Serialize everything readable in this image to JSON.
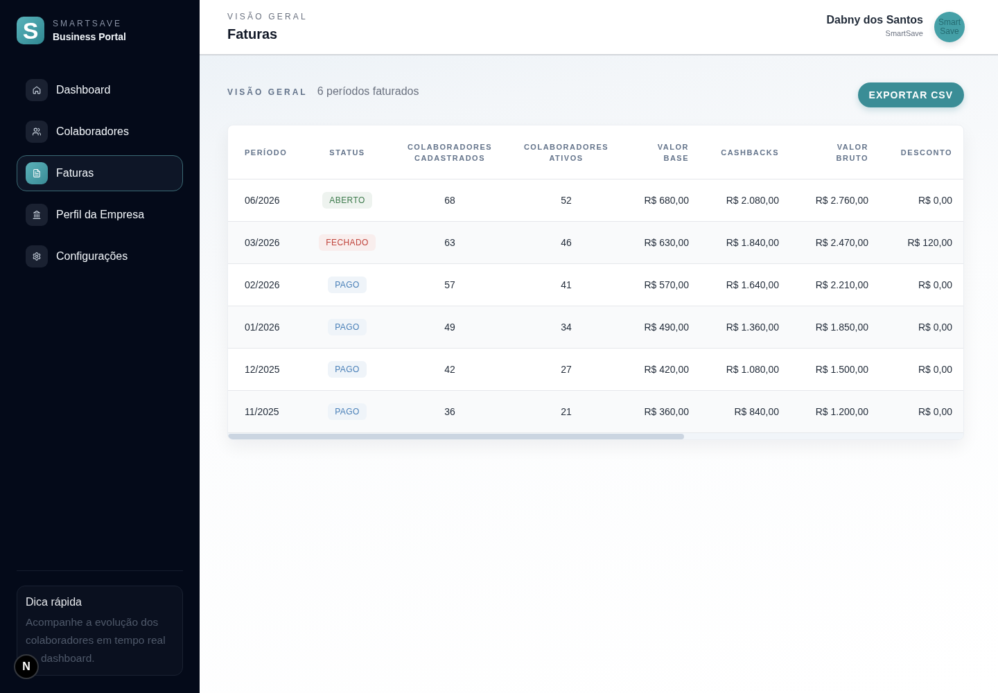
{
  "sidebar": {
    "logo": {
      "letter": "S",
      "brand": "SMARTSAVE",
      "subtitle": "Business Portal"
    },
    "items": [
      {
        "label": "Dashboard",
        "selected": false
      },
      {
        "label": "Colaboradores",
        "selected": false
      },
      {
        "label": "Faturas",
        "selected": true
      },
      {
        "label": "Perfil da Empresa",
        "selected": false
      },
      {
        "label": "Configurações",
        "selected": false
      }
    ],
    "tip": {
      "title": "Dica rápida",
      "text": "Acompanhe a evolução dos colaboradores em tempo real",
      "text_continued": "dashboard."
    },
    "dev_badge": {
      "letter": "N"
    }
  },
  "header": {
    "eyebrow": "VISÃO GERAL",
    "title": "Faturas",
    "user": {
      "name": "Dabny dos Santos",
      "company": "SmartSave",
      "avatar_alt": "SmartSave"
    }
  },
  "overview": {
    "label": "VISÃO GERAL",
    "summary": "6 períodos faturados",
    "export_button": "EXPORTAR CSV"
  },
  "table": {
    "columns": [
      {
        "label": "PERÍODO",
        "kind": "text"
      },
      {
        "label": "STATUS",
        "kind": "status"
      },
      {
        "label": "COLABORADORES CADASTRADOS",
        "kind": "count"
      },
      {
        "label": "COLABORADORES ATIVOS",
        "kind": "count"
      },
      {
        "label": "VALOR BASE",
        "kind": "money"
      },
      {
        "label": "CASHBACKS",
        "kind": "money"
      },
      {
        "label": "VALOR BRUTO",
        "kind": "money"
      },
      {
        "label": "DESCONTO",
        "kind": "money"
      }
    ],
    "rows": [
      {
        "cells": [
          "06/2026",
          {
            "label": "ABERTO",
            "color": "#3d7a4c"
          },
          "68",
          "52",
          "R$ 680,00",
          "R$ 2.080,00",
          "R$ 2.760,00",
          "R$ 0,00"
        ]
      },
      {
        "cells": [
          "03/2026",
          {
            "label": "FECHADO",
            "color": "#c0443c"
          },
          "63",
          "46",
          "R$ 630,00",
          "R$ 1.840,00",
          "R$ 2.470,00",
          "R$ 120,00"
        ]
      },
      {
        "cells": [
          "02/2026",
          {
            "label": "PAGO",
            "color": "#4a80b8"
          },
          "57",
          "41",
          "R$ 570,00",
          "R$ 1.640,00",
          "R$ 2.210,00",
          "R$ 0,00"
        ]
      },
      {
        "cells": [
          "01/2026",
          {
            "label": "PAGO",
            "color": "#4a80b8"
          },
          "49",
          "34",
          "R$ 490,00",
          "R$ 1.360,00",
          "R$ 1.850,00",
          "R$ 0,00"
        ]
      },
      {
        "cells": [
          "12/2025",
          {
            "label": "PAGO",
            "color": "#4a80b8"
          },
          "42",
          "27",
          "R$ 420,00",
          "R$ 1.080,00",
          "R$ 1.500,00",
          "R$ 0,00"
        ]
      },
      {
        "cells": [
          "11/2025",
          {
            "label": "PAGO",
            "color": "#4a80b8"
          },
          "36",
          "21",
          "R$ 360,00",
          "R$ 840,00",
          "R$ 1.200,00",
          "R$ 0,00"
        ]
      }
    ]
  }
}
